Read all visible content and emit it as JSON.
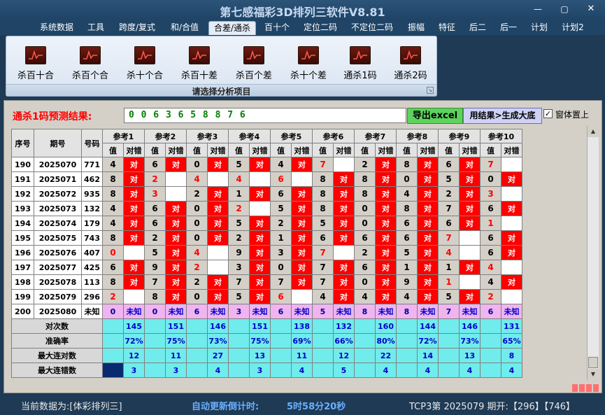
{
  "app": {
    "title": "第七感福彩3D排列三软件V8.81"
  },
  "window_controls": {
    "minimize": "—",
    "maximize": "▢",
    "close": "✕"
  },
  "menu": [
    {
      "label": "系统数据",
      "active": false
    },
    {
      "label": "工具",
      "active": false
    },
    {
      "label": "跨度/复式",
      "active": false
    },
    {
      "label": "和/合值",
      "active": false
    },
    {
      "label": "合差/通杀",
      "active": true
    },
    {
      "label": "百十个",
      "active": false
    },
    {
      "label": "定位二码",
      "active": false
    },
    {
      "label": "不定位二码",
      "active": false
    },
    {
      "label": "振幅",
      "active": false
    },
    {
      "label": "特征",
      "active": false
    },
    {
      "label": "后二",
      "active": false
    },
    {
      "label": "后一",
      "active": false
    },
    {
      "label": "计划",
      "active": false
    },
    {
      "label": "计划2",
      "active": false
    }
  ],
  "ribbon": {
    "buttons": [
      "杀百十合",
      "杀百个合",
      "杀十个合",
      "杀百十差",
      "杀百个差",
      "杀十个差",
      "通杀1码",
      "通杀2码"
    ],
    "icon": "chart-icon",
    "caption": "请选择分析项目"
  },
  "prediction": {
    "label": "通杀1码预测结果:",
    "value": "0 0 6 3 6 5 8 8 7 6",
    "export_button": "导出excel",
    "generate_button": "用结果>生成大底",
    "topmost_label": "窗体置上",
    "topmost_checked": true,
    "check_mark": "✓"
  },
  "grid": {
    "headers": {
      "seq": "序号",
      "period": "期号",
      "number": "号码"
    },
    "refs": [
      "参考1",
      "参考2",
      "参考3",
      "参考4",
      "参考5",
      "参考6",
      "参考7",
      "参考8",
      "参考9",
      "参考10"
    ],
    "sub_value": "值",
    "sub_result": "对错",
    "hit_text": "对",
    "unknown_text": "未知",
    "rows": [
      {
        "seq": "190",
        "period": "2025070",
        "num": "771",
        "vals": [
          "4",
          "6",
          "0",
          "5",
          "4",
          "7",
          "2",
          "8",
          "6",
          "7"
        ],
        "hits": [
          1,
          1,
          1,
          1,
          1,
          0,
          1,
          1,
          1,
          0
        ],
        "red": [
          0,
          0,
          0,
          0,
          0,
          1,
          0,
          0,
          0,
          1
        ]
      },
      {
        "seq": "191",
        "period": "2025071",
        "num": "462",
        "vals": [
          "8",
          "2",
          "4",
          "4",
          "6",
          "8",
          "8",
          "0",
          "5",
          "0"
        ],
        "hits": [
          1,
          0,
          0,
          0,
          0,
          1,
          1,
          1,
          1,
          1
        ],
        "red": [
          0,
          1,
          1,
          1,
          1,
          0,
          0,
          0,
          0,
          0
        ]
      },
      {
        "seq": "192",
        "period": "2025072",
        "num": "935",
        "vals": [
          "8",
          "3",
          "2",
          "1",
          "6",
          "8",
          "8",
          "4",
          "2",
          "3"
        ],
        "hits": [
          1,
          0,
          1,
          1,
          1,
          1,
          1,
          1,
          1,
          0
        ],
        "red": [
          0,
          1,
          0,
          0,
          0,
          0,
          0,
          0,
          0,
          1
        ]
      },
      {
        "seq": "193",
        "period": "2025073",
        "num": "132",
        "vals": [
          "4",
          "6",
          "0",
          "2",
          "5",
          "8",
          "0",
          "8",
          "7",
          "6"
        ],
        "hits": [
          1,
          1,
          1,
          0,
          1,
          1,
          1,
          1,
          1,
          1
        ],
        "red": [
          0,
          0,
          0,
          1,
          0,
          0,
          0,
          0,
          0,
          0
        ]
      },
      {
        "seq": "194",
        "period": "2025074",
        "num": "179",
        "vals": [
          "4",
          "6",
          "0",
          "5",
          "2",
          "5",
          "0",
          "6",
          "6",
          "1"
        ],
        "hits": [
          1,
          1,
          1,
          1,
          1,
          1,
          1,
          1,
          1,
          0
        ],
        "red": [
          0,
          0,
          0,
          0,
          0,
          0,
          0,
          0,
          0,
          1
        ]
      },
      {
        "seq": "195",
        "period": "2025075",
        "num": "743",
        "vals": [
          "8",
          "2",
          "0",
          "2",
          "1",
          "6",
          "6",
          "6",
          "7",
          "6"
        ],
        "hits": [
          1,
          1,
          1,
          1,
          1,
          1,
          1,
          1,
          0,
          1
        ],
        "red": [
          0,
          0,
          0,
          0,
          0,
          0,
          0,
          0,
          1,
          0
        ]
      },
      {
        "seq": "196",
        "period": "2025076",
        "num": "407",
        "vals": [
          "0",
          "5",
          "4",
          "9",
          "3",
          "7",
          "2",
          "5",
          "4",
          "6"
        ],
        "hits": [
          0,
          1,
          0,
          1,
          1,
          0,
          1,
          1,
          0,
          1
        ],
        "red": [
          1,
          0,
          1,
          0,
          0,
          1,
          0,
          0,
          1,
          0
        ]
      },
      {
        "seq": "197",
        "period": "2025077",
        "num": "425",
        "vals": [
          "6",
          "9",
          "2",
          "3",
          "0",
          "7",
          "6",
          "1",
          "1",
          "4"
        ],
        "hits": [
          1,
          1,
          0,
          1,
          1,
          1,
          1,
          1,
          1,
          0
        ],
        "red": [
          0,
          0,
          1,
          0,
          0,
          0,
          0,
          0,
          0,
          1
        ]
      },
      {
        "seq": "198",
        "period": "2025078",
        "num": "113",
        "vals": [
          "8",
          "7",
          "2",
          "7",
          "7",
          "7",
          "0",
          "9",
          "1",
          "4"
        ],
        "hits": [
          1,
          1,
          1,
          1,
          1,
          1,
          1,
          1,
          0,
          1
        ],
        "red": [
          0,
          0,
          0,
          0,
          0,
          0,
          0,
          0,
          1,
          0
        ]
      },
      {
        "seq": "199",
        "period": "2025079",
        "num": "296",
        "vals": [
          "2",
          "8",
          "0",
          "5",
          "6",
          "4",
          "4",
          "4",
          "5",
          "2"
        ],
        "hits": [
          0,
          1,
          1,
          1,
          0,
          1,
          1,
          1,
          1,
          0
        ],
        "red": [
          1,
          0,
          0,
          0,
          1,
          0,
          0,
          0,
          0,
          1
        ]
      }
    ],
    "unknown_row": {
      "seq": "200",
      "period": "2025080",
      "num": "未知",
      "vals": [
        "0",
        "0",
        "6",
        "3",
        "6",
        "5",
        "8",
        "8",
        "7",
        "6"
      ]
    },
    "stats": [
      {
        "label": "对次数",
        "values": [
          "145",
          "151",
          "146",
          "151",
          "138",
          "132",
          "160",
          "144",
          "146",
          "131"
        ]
      },
      {
        "label": "准确率",
        "values": [
          "72%",
          "75%",
          "73%",
          "75%",
          "69%",
          "66%",
          "80%",
          "72%",
          "73%",
          "65%"
        ]
      },
      {
        "label": "最大连对数",
        "values": [
          "12",
          "11",
          "27",
          "13",
          "11",
          "12",
          "22",
          "14",
          "13",
          "8"
        ]
      },
      {
        "label": "最大连错数",
        "values": [
          "3",
          "3",
          "4",
          "3",
          "4",
          "5",
          "4",
          "4",
          "4",
          "4"
        ]
      }
    ]
  },
  "status": {
    "source": "当前数据为:[体彩排列三]",
    "countdown_label": "自动更新倒计时:",
    "countdown": "5时58分20秒",
    "tcp": "TCP3第 2025079 期开:【296】【746】"
  }
}
